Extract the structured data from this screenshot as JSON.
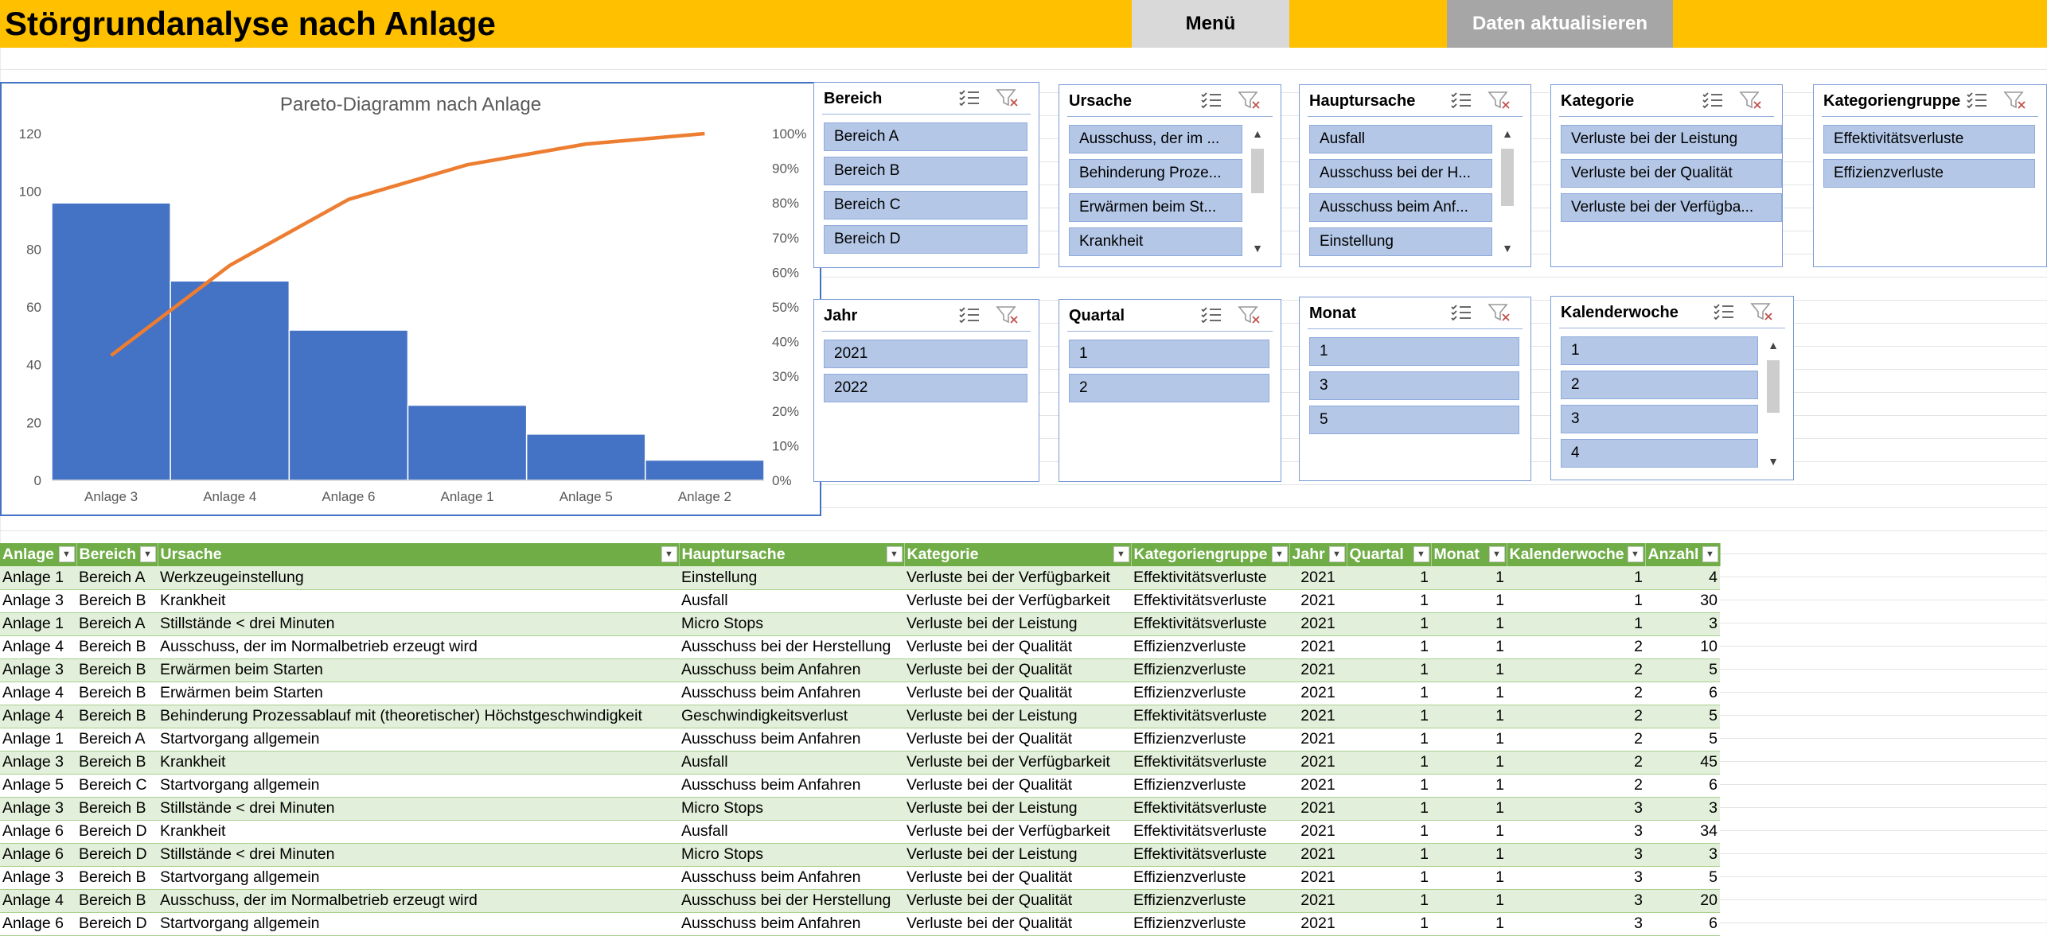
{
  "header": {
    "title": "Störgrundanalyse nach Anlage",
    "menu_label": "Menü",
    "refresh_label": "Daten aktualisieren",
    "accent_color": "#ffc000"
  },
  "chart_data": {
    "type": "bar",
    "title": "Pareto-Diagramm nach Anlage",
    "categories": [
      "Anlage 3",
      "Anlage 4",
      "Anlage 6",
      "Anlage 1",
      "Anlage 5",
      "Anlage 2"
    ],
    "values": [
      96,
      69,
      52,
      26,
      16,
      7
    ],
    "cumulative_percent": [
      36,
      62,
      81,
      91,
      97,
      100
    ],
    "ylim": [
      0,
      120
    ],
    "y_ticks": [
      "0",
      "20",
      "40",
      "60",
      "80",
      "100",
      "120"
    ],
    "y2lim": [
      0,
      100
    ],
    "y2_ticks": [
      "0%",
      "10%",
      "20%",
      "30%",
      "40%",
      "50%",
      "60%",
      "70%",
      "80%",
      "90%",
      "100%"
    ],
    "bar_color": "#4472c4",
    "line_color": "#ed7d31",
    "grid": false
  },
  "slicers": {
    "bereich": {
      "title": "Bereich",
      "items": [
        "Bereich A",
        "Bereich B",
        "Bereich C",
        "Bereich D"
      ]
    },
    "ursache": {
      "title": "Ursache",
      "items": [
        "Ausschuss, der im ...",
        "Behinderung Proze...",
        "Erwärmen beim St...",
        "Krankheit"
      ]
    },
    "hauptursache": {
      "title": "Hauptursache",
      "items": [
        "Ausfall",
        "Ausschuss bei der H...",
        "Ausschuss beim Anf...",
        "Einstellung"
      ]
    },
    "kategorie": {
      "title": "Kategorie",
      "items": [
        "Verluste bei der Leistung",
        "Verluste bei der Qualität",
        "Verluste bei der Verfügba..."
      ]
    },
    "kategoriengruppe": {
      "title": "Kategoriengruppe",
      "items": [
        "Effektivitätsverluste",
        "Effizienzverluste"
      ]
    },
    "jahr": {
      "title": "Jahr",
      "items": [
        "2021",
        "2022"
      ]
    },
    "quartal": {
      "title": "Quartal",
      "items": [
        "1",
        "2"
      ]
    },
    "monat": {
      "title": "Monat",
      "items": [
        "1",
        "3",
        "5"
      ]
    },
    "kalenderwoche": {
      "title": "Kalenderwoche",
      "items": [
        "1",
        "2",
        "3",
        "4"
      ]
    }
  },
  "table": {
    "columns": [
      "Anlage",
      "Bereich",
      "Ursache",
      "Hauptursache",
      "Kategorie",
      "Kategoriengruppe",
      "Jahr",
      "Quartal",
      "Monat",
      "Kalenderwoche",
      "Anzahl"
    ],
    "rows": [
      [
        "Anlage 1",
        "Bereich A",
        "Werkzeugeinstellung",
        "Einstellung",
        "Verluste bei der Verfügbarkeit",
        "Effektivitätsverluste",
        "2021",
        "1",
        "1",
        "1",
        "4"
      ],
      [
        "Anlage 3",
        "Bereich B",
        "Krankheit",
        "Ausfall",
        "Verluste bei der Verfügbarkeit",
        "Effektivitätsverluste",
        "2021",
        "1",
        "1",
        "1",
        "30"
      ],
      [
        "Anlage 1",
        "Bereich A",
        "Stillstände < drei Minuten",
        "Micro Stops",
        "Verluste bei der Leistung",
        "Effektivitätsverluste",
        "2021",
        "1",
        "1",
        "1",
        "3"
      ],
      [
        "Anlage 4",
        "Bereich B",
        "Ausschuss, der im Normalbetrieb erzeugt wird",
        "Ausschuss bei der Herstellung",
        "Verluste bei der Qualität",
        "Effizienzverluste",
        "2021",
        "1",
        "1",
        "2",
        "10"
      ],
      [
        "Anlage 3",
        "Bereich B",
        "Erwärmen beim Starten",
        "Ausschuss beim Anfahren",
        "Verluste bei der Qualität",
        "Effizienzverluste",
        "2021",
        "1",
        "1",
        "2",
        "5"
      ],
      [
        "Anlage 4",
        "Bereich B",
        "Erwärmen beim Starten",
        "Ausschuss beim Anfahren",
        "Verluste bei der Qualität",
        "Effizienzverluste",
        "2021",
        "1",
        "1",
        "2",
        "6"
      ],
      [
        "Anlage 4",
        "Bereich B",
        "Behinderung Prozessablauf mit (theoretischer) Höchstgeschwindigkeit",
        "Geschwindigkeitsverlust",
        "Verluste bei der Leistung",
        "Effektivitätsverluste",
        "2021",
        "1",
        "1",
        "2",
        "5"
      ],
      [
        "Anlage 1",
        "Bereich A",
        "Startvorgang allgemein",
        "Ausschuss beim Anfahren",
        "Verluste bei der Qualität",
        "Effizienzverluste",
        "2021",
        "1",
        "1",
        "2",
        "5"
      ],
      [
        "Anlage 3",
        "Bereich B",
        "Krankheit",
        "Ausfall",
        "Verluste bei der Verfügbarkeit",
        "Effektivitätsverluste",
        "2021",
        "1",
        "1",
        "2",
        "45"
      ],
      [
        "Anlage 5",
        "Bereich C",
        "Startvorgang allgemein",
        "Ausschuss beim Anfahren",
        "Verluste bei der Qualität",
        "Effizienzverluste",
        "2021",
        "1",
        "1",
        "2",
        "6"
      ],
      [
        "Anlage 3",
        "Bereich B",
        "Stillstände < drei Minuten",
        "Micro Stops",
        "Verluste bei der Leistung",
        "Effektivitätsverluste",
        "2021",
        "1",
        "1",
        "3",
        "3"
      ],
      [
        "Anlage 6",
        "Bereich D",
        "Krankheit",
        "Ausfall",
        "Verluste bei der Verfügbarkeit",
        "Effektivitätsverluste",
        "2021",
        "1",
        "1",
        "3",
        "34"
      ],
      [
        "Anlage 6",
        "Bereich D",
        "Stillstände < drei Minuten",
        "Micro Stops",
        "Verluste bei der Leistung",
        "Effektivitätsverluste",
        "2021",
        "1",
        "1",
        "3",
        "3"
      ],
      [
        "Anlage 3",
        "Bereich B",
        "Startvorgang allgemein",
        "Ausschuss beim Anfahren",
        "Verluste bei der Qualität",
        "Effizienzverluste",
        "2021",
        "1",
        "1",
        "3",
        "5"
      ],
      [
        "Anlage 4",
        "Bereich B",
        "Ausschuss, der im Normalbetrieb erzeugt wird",
        "Ausschuss bei der Herstellung",
        "Verluste bei der Qualität",
        "Effizienzverluste",
        "2021",
        "1",
        "1",
        "3",
        "20"
      ],
      [
        "Anlage 6",
        "Bereich D",
        "Startvorgang allgemein",
        "Ausschuss beim Anfahren",
        "Verluste bei der Qualität",
        "Effizienzverluste",
        "2021",
        "1",
        "1",
        "3",
        "6"
      ]
    ]
  }
}
